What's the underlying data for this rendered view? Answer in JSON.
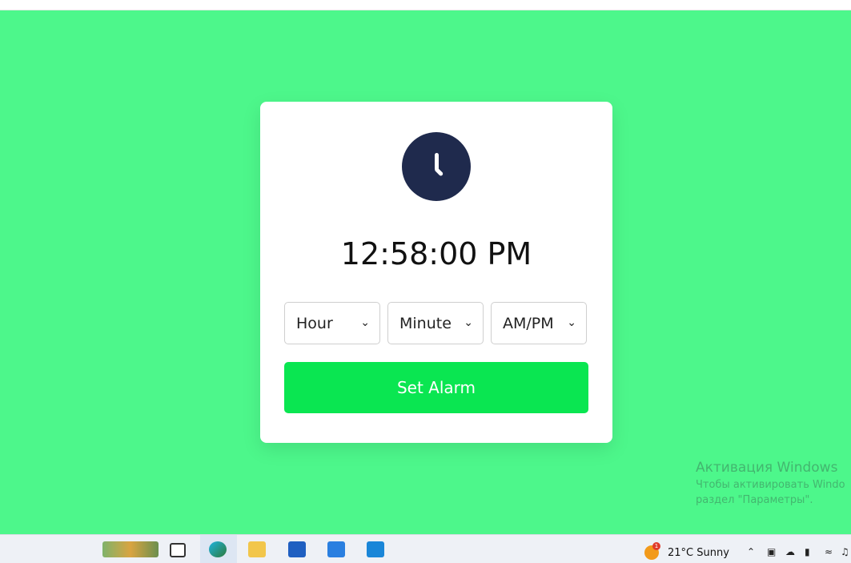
{
  "alarm_app": {
    "current_time": "12:58:00 PM",
    "hour_select": {
      "value": "Hour",
      "options": [
        "Hour"
      ]
    },
    "minute_select": {
      "value": "Minute",
      "options": [
        "Minute"
      ]
    },
    "ampm_select": {
      "value": "AM/PM",
      "options": [
        "AM/PM"
      ]
    },
    "set_alarm_label": "Set Alarm",
    "background_color": "#4df78b",
    "button_color": "#0ae651",
    "clock_icon": "clock-icon"
  },
  "windows_activation": {
    "title": "Активация Windows",
    "line1": "Чтобы активировать Windo",
    "line2": "раздел \"Параметры\"."
  },
  "taskbar": {
    "weather_temp": "21°C",
    "weather_condition": "Sunny",
    "weather_badge": "1",
    "icons": [
      "landscape-widget-icon",
      "task-view-icon",
      "edge-icon",
      "file-explorer-icon",
      "store-icon",
      "mail-icon",
      "vscode-icon"
    ]
  }
}
